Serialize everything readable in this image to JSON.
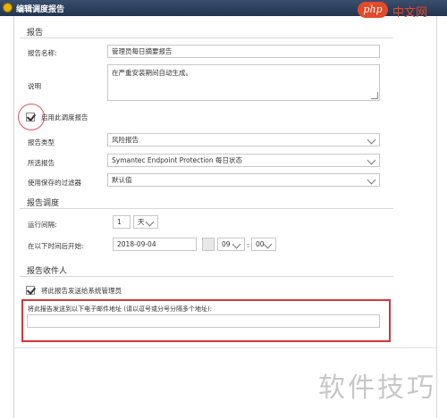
{
  "window": {
    "title": "编辑调度报告"
  },
  "watermark": {
    "badge": "php",
    "site": "中文网",
    "bottom": "软件技巧"
  },
  "report_section": {
    "title": "报告",
    "name_label": "报告名称:",
    "name_value": "管理员每日摘要报告",
    "desc_label": "说明",
    "desc_value": "在严重安装期间自动生成。",
    "enable_label": "启用此调度报告",
    "type_label": "报告类型",
    "type_value": "风险报告",
    "selected_label": "所选报告",
    "selected_value": "Symantec Endpoint Protection 每日状态",
    "filter_label": "使用保存的过滤器",
    "filter_value": "默认值"
  },
  "schedule_section": {
    "title": "报告调度",
    "interval_label": "运行间隔:",
    "interval_value": "1",
    "interval_unit": "天",
    "start_label": "在以下时间后开始:",
    "start_date": "2018-09-04",
    "start_hour": "09",
    "start_sep": ":",
    "start_minute": "00"
  },
  "recipients_section": {
    "title": "报告收件人",
    "send_admin_label": "将此报告发送给系统管理员",
    "email_label": "将此报告发送到以下电子邮件地址 (请以逗号或分号分隔多个地址):",
    "email_value": ""
  },
  "colors": {
    "accent_red": "#d9343a",
    "title_bar": "#2c3e5c"
  }
}
